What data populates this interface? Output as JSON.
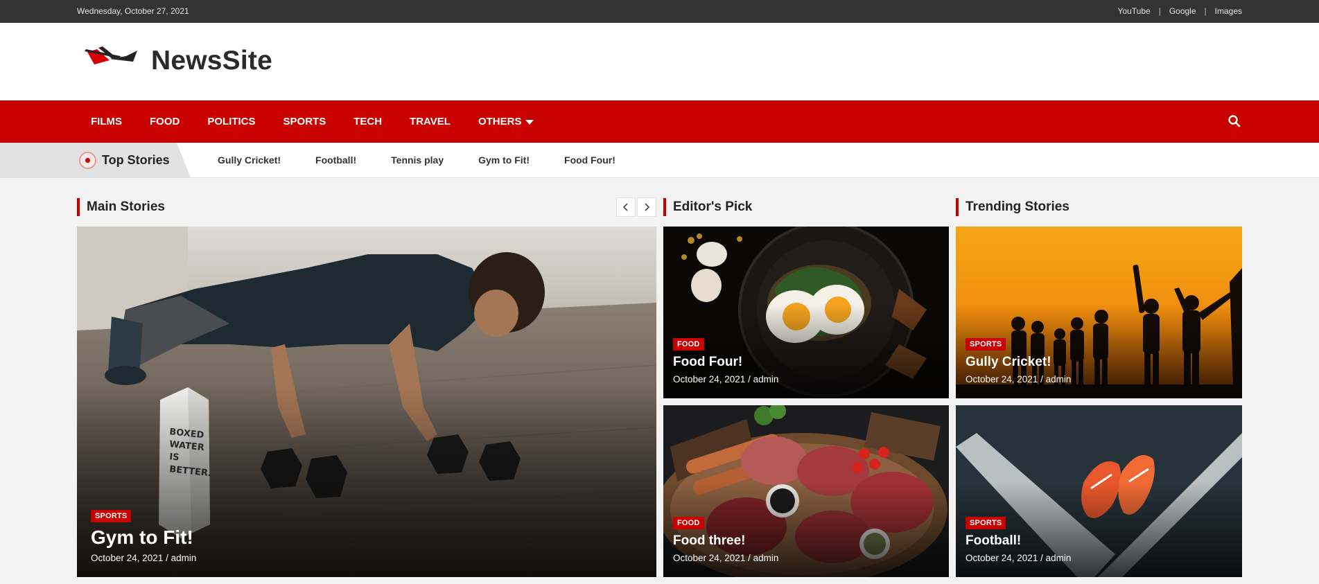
{
  "topbar": {
    "date": "Wednesday, October 27, 2021",
    "links": [
      "YouTube",
      "Google",
      "Images"
    ],
    "separator": "|"
  },
  "header": {
    "site_name": "NewsSite",
    "logo_icon": "site-logo-icon"
  },
  "nav": {
    "items": [
      "FILMS",
      "FOOD",
      "POLITICS",
      "SPORTS",
      "TECH",
      "TRAVEL",
      "OTHERS"
    ],
    "search_icon": "search-icon",
    "brand_color": "#c80000"
  },
  "ticker": {
    "title": "Top Stories",
    "items": [
      "Gully Cricket!",
      "Football!",
      "Tennis play",
      "Gym to Fit!",
      "Food Four!"
    ]
  },
  "sections": {
    "main": "Main Stories",
    "editors": "Editor's Pick",
    "trending": "Trending Stories"
  },
  "main_story": {
    "category": "SPORTS",
    "title": "Gym to Fit!",
    "byline": "October 24, 2021 / admin"
  },
  "editors_pick": [
    {
      "category": "FOOD",
      "title": "Food Four!",
      "byline": "October 24, 2021 / admin"
    },
    {
      "category": "FOOD",
      "title": "Food three!",
      "byline": "October 24, 2021 / admin"
    }
  ],
  "trending": [
    {
      "category": "SPORTS",
      "title": "Gully Cricket!",
      "byline": "October 24, 2021 / admin"
    },
    {
      "category": "SPORTS",
      "title": "Football!",
      "byline": "October 24, 2021 / admin"
    }
  ]
}
